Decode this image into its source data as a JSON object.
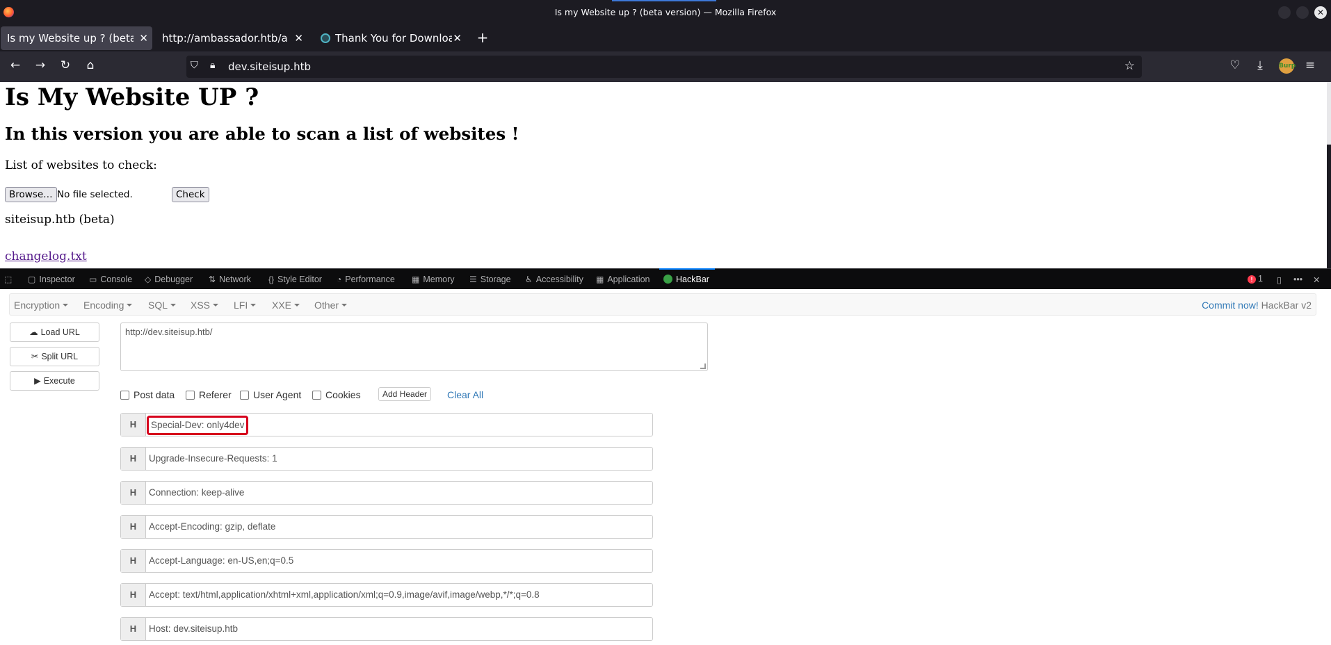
{
  "window": {
    "title": "Is my Website up ? (beta version) — Mozilla Firefox"
  },
  "tabs": [
    {
      "label": "Is my Website up ? (beta version)",
      "active": true
    },
    {
      "label": "http://ambassador.htb/ananke",
      "active": false
    },
    {
      "label": "Thank You for Downloading",
      "active": false
    }
  ],
  "navbar": {
    "url": "dev.siteisup.htb",
    "avatar_text": "Burp"
  },
  "page": {
    "heading": "Is My Website UP ?",
    "subheading": "In this version you are able to scan a list of websites !",
    "list_label": "List of websites to check:",
    "browse_label": "Browse…",
    "file_status": "No file selected.",
    "check_label": "Check",
    "footer_text": "siteisup.htb (beta)",
    "changelog_link": "changelog.txt"
  },
  "devtools": {
    "tabs": [
      "Inspector",
      "Console",
      "Debugger",
      "Network",
      "Style Editor",
      "Performance",
      "Memory",
      "Storage",
      "Accessibility",
      "Application",
      "HackBar"
    ],
    "error_count": "1"
  },
  "hackbar": {
    "menus": [
      "Encryption",
      "Encoding",
      "SQL",
      "XSS",
      "LFI",
      "XXE",
      "Other"
    ],
    "commit_link": "Commit now!",
    "version": "HackBar v2",
    "buttons": [
      "Load URL",
      "Split URL",
      "Execute"
    ],
    "url_value": "http://dev.siteisup.htb/",
    "options": [
      "Post data",
      "Referer",
      "User Agent",
      "Cookies"
    ],
    "add_header": "Add Header",
    "clear_all": "Clear All",
    "header_badge": "H",
    "headers": [
      "Special-Dev: only4dev",
      "Upgrade-Insecure-Requests: 1",
      "Connection: keep-alive",
      "Accept-Encoding: gzip, deflate",
      "Accept-Language: en-US,en;q=0.5",
      "Accept: text/html,application/xhtml+xml,application/xml;q=0.9,image/avif,image/webp,*/*;q=0.8",
      "Host: dev.siteisup.htb"
    ]
  },
  "colors": {
    "highlight": "#d6001c",
    "link": "#551a8b",
    "accent": "#337ab7"
  }
}
